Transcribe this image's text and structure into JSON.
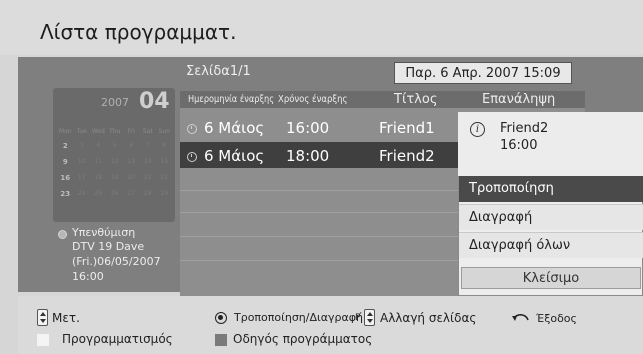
{
  "header": {
    "title": "Λίστα προγραμματ."
  },
  "top": {
    "page_indicator": "Σελίδα1/1",
    "datetime": "Παρ. 6 Απρ. 2007 15:09"
  },
  "calendar": {
    "year": "2007",
    "month": "04",
    "weekday_headers": [
      "Mon",
      "Tue",
      "Wed",
      "Thu",
      "Fri",
      "Sat",
      "Sun"
    ],
    "weeks": [
      [
        "2",
        "3",
        "4",
        "5",
        "6",
        "7",
        "8"
      ],
      [
        "9",
        "10",
        "11",
        "12",
        "13",
        "14",
        "15"
      ],
      [
        "16",
        "17",
        "18",
        "19",
        "20",
        "21",
        "22"
      ],
      [
        "23",
        "24",
        "25",
        "26",
        "27",
        "28",
        "29"
      ]
    ]
  },
  "reminder": {
    "label": "Υπενθύμιση",
    "lines": [
      "DTV 19 Dave",
      "(Fri.)06/05/2007",
      "16:00"
    ]
  },
  "table": {
    "columns": [
      "Ημερομηνία έναρξης",
      "Χρόνος έναρξης",
      "Τίτλος",
      "Επανάληψη"
    ],
    "rows": [
      {
        "date": "6 Μάιος",
        "time": "16:00",
        "title": "Friend1"
      },
      {
        "date": "6 Μάιος",
        "time": "18:00",
        "title": "Friend2"
      }
    ]
  },
  "popup": {
    "info_title": "Friend2",
    "info_time": "16:00",
    "items": [
      "Τροποποίηση",
      "Διαγραφή",
      "Διαγραφή όλων"
    ],
    "close": "Κλείσιμο"
  },
  "legend": {
    "move": "Μετ.",
    "modify_delete": "Τροποποίηση/Διαγραφή",
    "page_prefix": "P",
    "page_change": "Αλλαγή σελίδας",
    "exit": "Έξοδος",
    "schedule": "Προγραμματισμός",
    "guide": "Οδηγός προγράμματος"
  },
  "colors": {
    "selected_row": "#3f3f3f",
    "selected_menu": "#4a4a4a",
    "schedule_key": "#f4f4f4",
    "guide_key": "#7a7a7a"
  }
}
